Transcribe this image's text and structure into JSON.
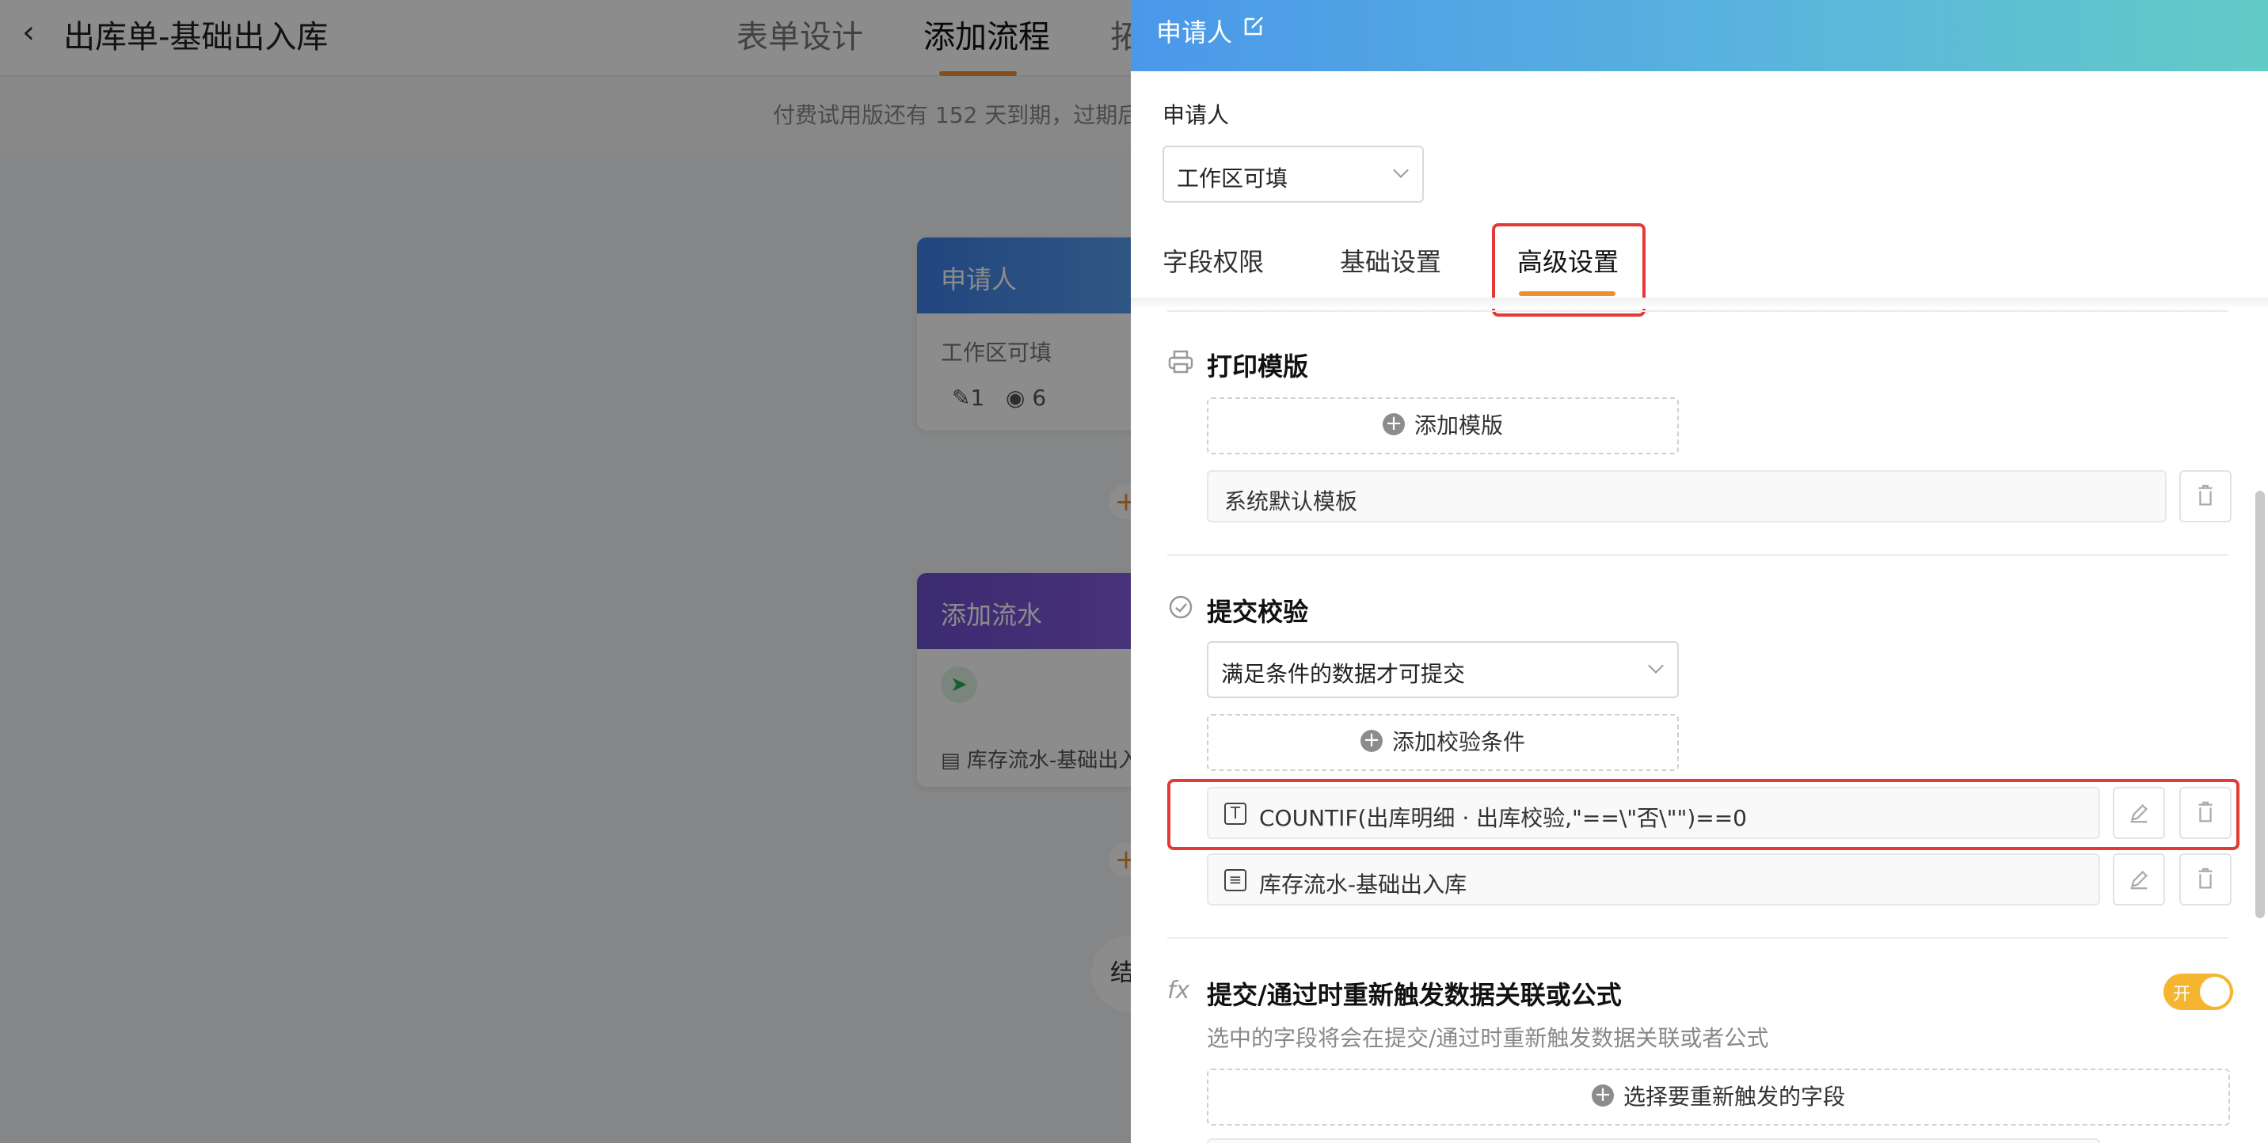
{
  "background": {
    "back_icon": "chevron-left-icon",
    "title": "出库单-基础出入库",
    "tabs": [
      "表单设计",
      "添加流程",
      "拓"
    ],
    "notice": "付费试用版还有 152 天到期，过期后",
    "nodes": [
      {
        "title": "申请人",
        "subtitle": "工作区可填",
        "edit_count": "1",
        "view_count": "6"
      },
      {
        "title": "添加流水",
        "line": "库存流水-基础出入"
      }
    ],
    "end_label": "结"
  },
  "drawer": {
    "title": "申请人",
    "edit_icon": "edit-icon",
    "applicant_label": "申请人",
    "applicant_select": "工作区可填",
    "tabs": [
      "字段权限",
      "基础设置",
      "高级设置"
    ],
    "active_tab": "高级设置",
    "print": {
      "title": "打印模版",
      "icon": "printer-icon",
      "add_label": "添加模版",
      "templates": [
        "系统默认模板"
      ]
    },
    "validation": {
      "title": "提交校验",
      "icon": "check-shield-icon",
      "mode": "满足条件的数据才可提交",
      "add_label": "添加校验条件",
      "conditions": [
        {
          "icon": "formula-icon",
          "text": "COUNTIF(出库明细 · 出库校验,\"==\\\"否\\\"\")==0"
        },
        {
          "icon": "form-icon",
          "text": "库存流水-基础出入库"
        }
      ]
    },
    "retrigger": {
      "title": "提交/通过时重新触发数据关联或公式",
      "icon": "fx-icon",
      "toggle_label": "开",
      "toggle_on": true,
      "hint": "选中的字段将会在提交/通过时重新触发数据关联或者公式",
      "add_label": "选择要重新触发的字段"
    }
  },
  "colors": {
    "accent": "#ef8f2c",
    "highlight": "#e53935",
    "toggle": "#f5b530"
  }
}
